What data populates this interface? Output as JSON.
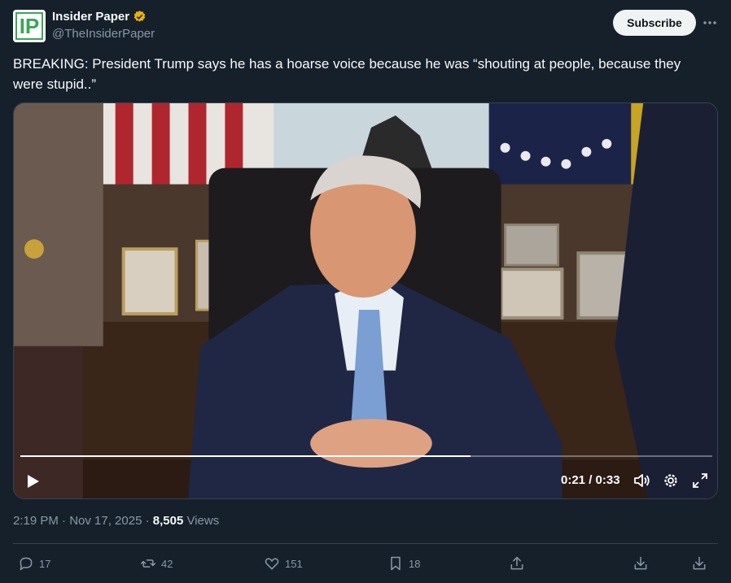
{
  "author": {
    "display_name": "Insider Paper",
    "handle": "@TheInsiderPaper",
    "avatar_text": "IP",
    "verified_color": "#e8b20d"
  },
  "header": {
    "subscribe_label": "Subscribe"
  },
  "tweet": {
    "text": "BREAKING: President Trump says he has a hoarse voice because he was “shouting at people, because they were stupid..”"
  },
  "video": {
    "time_label": "0:21 / 0:33",
    "progress": 0.65
  },
  "meta": {
    "timestamp": "2:19 PM · Nov 17, 2025",
    "separator": " · ",
    "views_count": "8,505",
    "views_label": " Views"
  },
  "actions": {
    "replies": "17",
    "reposts": "42",
    "likes": "151",
    "bookmarks": "18"
  },
  "colors": {
    "background": "#15202b",
    "text": "#f7f9f9",
    "secondary": "#8b98a5"
  }
}
